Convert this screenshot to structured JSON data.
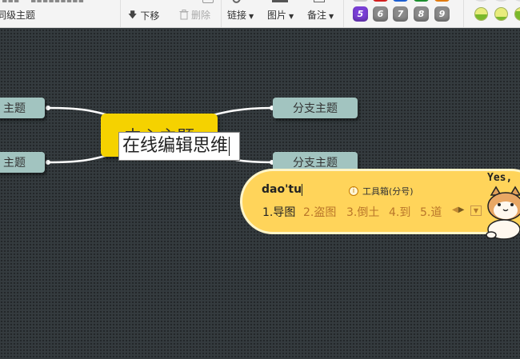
{
  "toolbar": {
    "top_left_cut": "▪▪▪ ─ ▪▪▪▪▪▪▪▪▪",
    "sibling_topic_label": "同级主题",
    "move_down_label": "下移",
    "delete_label": "删除",
    "link_label": "链接",
    "image_label": "图片",
    "note_label": "备注",
    "priority_badges": [
      {
        "label": "5",
        "color": "#7a3fd6"
      },
      {
        "label": "6",
        "color": "#8b8b8b"
      },
      {
        "label": "7",
        "color": "#8b8b8b"
      },
      {
        "label": "8",
        "color": "#8b8b8b"
      },
      {
        "label": "9",
        "color": "#8b8b8b"
      }
    ],
    "progress_icons": [
      0.5,
      0.25,
      0.75
    ]
  },
  "mindmap": {
    "central_topic": "中心主题",
    "left_branches": [
      "主题",
      "主题"
    ],
    "right_branches": [
      "分支主题",
      "分支主题"
    ],
    "editor_text": "在线编辑思维"
  },
  "ime": {
    "pinyin": "dao'tu",
    "toolbox_label": "工具箱(分号)",
    "candidates": [
      "1.导图",
      "2.盗图",
      "3.倒土",
      "4.到",
      "5.道"
    ],
    "sticker_text": "Yes,"
  },
  "colors": {
    "canvas_bg": "#343b3e",
    "branch_fill": "#a2c4c0",
    "central_fill": "#f5d200",
    "ime_fill": "#ffd45a"
  }
}
